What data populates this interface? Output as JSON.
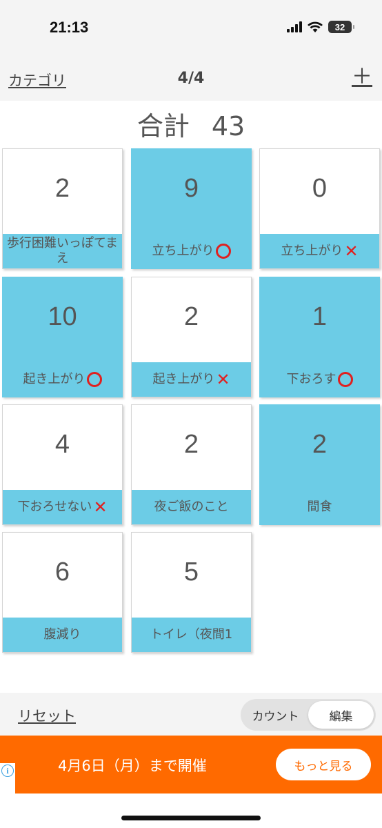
{
  "status": {
    "time": "21:13",
    "battery": "32"
  },
  "nav": {
    "category": "カテゴリ",
    "page": "4/4",
    "add": "＋"
  },
  "total": {
    "label": "合計",
    "value": "43"
  },
  "tiles": [
    {
      "count": "2",
      "label": "歩行困難いっぽてまえ",
      "active": false,
      "mark": ""
    },
    {
      "count": "9",
      "label": "立ち上がり",
      "active": true,
      "mark": "o"
    },
    {
      "count": "0",
      "label": "立ち上がり",
      "active": false,
      "mark": "x"
    },
    {
      "count": "10",
      "label": "起き上がり",
      "active": true,
      "mark": "o"
    },
    {
      "count": "2",
      "label": "起き上がり",
      "active": false,
      "mark": "x"
    },
    {
      "count": "1",
      "label": "下おろす",
      "active": true,
      "mark": "o"
    },
    {
      "count": "4",
      "label": "下おろせない",
      "active": false,
      "mark": "x"
    },
    {
      "count": "2",
      "label": "夜ご飯のこと",
      "active": false,
      "mark": ""
    },
    {
      "count": "2",
      "label": "間食",
      "active": true,
      "mark": ""
    },
    {
      "count": "6",
      "label": "腹減り",
      "active": false,
      "mark": ""
    },
    {
      "count": "5",
      "label": "トイレ（夜間1",
      "active": false,
      "mark": ""
    }
  ],
  "bottom": {
    "reset": "リセット",
    "mode_count": "カウント",
    "mode_edit": "編集",
    "selected": "edit"
  },
  "banner": {
    "text": "4月6日（月）まで開催",
    "button": "もっと見る"
  },
  "colors": {
    "tile_accent": "#6ccce6",
    "banner": "#ff6a00",
    "mark": "#e02020"
  }
}
